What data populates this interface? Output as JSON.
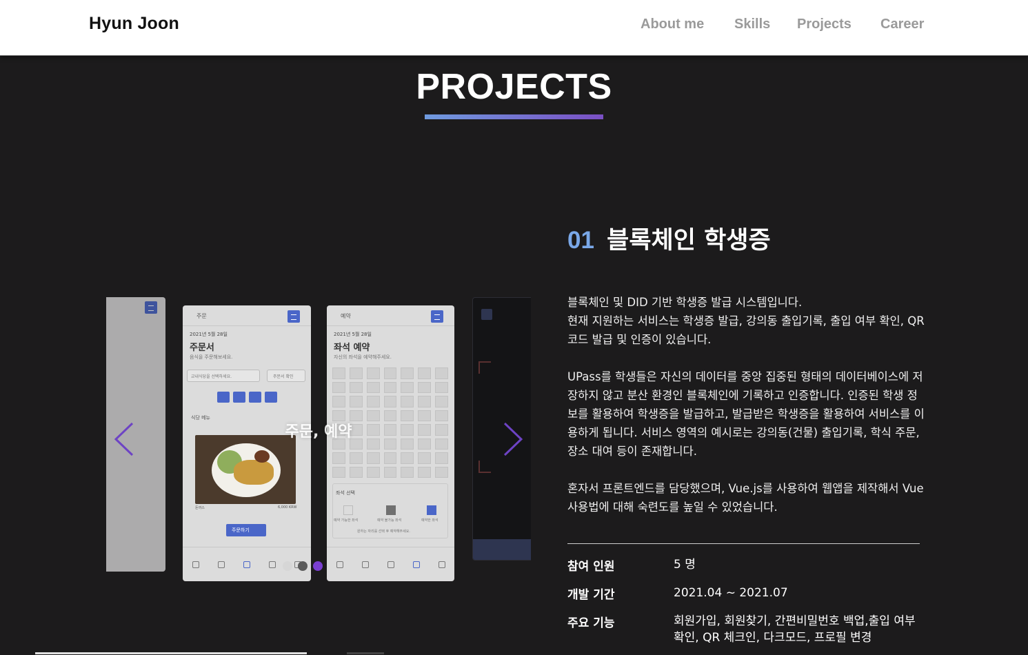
{
  "header": {
    "logo": "Hyun Joon",
    "nav": [
      "About me",
      "Skills",
      "Projects",
      "Career"
    ]
  },
  "section": {
    "title": "PROJECTS"
  },
  "carousel": {
    "overlay": "주문, 예약",
    "active_slide_index": 2,
    "slide_count": 3,
    "slides": {
      "order": {
        "top_label": "주문",
        "date": "2021년 5월 28일",
        "heading": "주문서",
        "sub": "음식을 주문해보세요.",
        "select_placeholder": "교내식당을 선택하세요.",
        "confirm": "주문서 확인",
        "menu_label": "식당 메뉴",
        "item_name": "돈까스",
        "item_price": "6,000 KRW",
        "order_button": "주문하기"
      },
      "reserve": {
        "top_label": "예약",
        "date": "2021년 5월 28일",
        "heading": "좌석 예약",
        "sub": "자신의 좌석을 예약해주세요.",
        "seat_label": "좌석 선택",
        "legend": [
          "예약 가능한 좌석",
          "예약 불가능 좌석",
          "예약한 좌석"
        ],
        "note": "원하는 자리를 선택 후 예약해주세요."
      }
    }
  },
  "project": {
    "number": "01",
    "title": "블록체인 학생증",
    "description": [
      "블록체인 및 DID 기반 학생증 발급 시스템입니다.\n현재 지원하는 서비스는 학생증 발급, 강의동 출입기록, 출입 여부 확인, QR 코드 발급 및 인증이 있습니다.",
      "UPass를 학생들은 자신의 데이터를 중앙 집중된 형태의 데이터베이스에 저장하지 않고 분산 환경인 블록체인에 기록하고 인증합니다. 인증된 학생 정보를 활용하여 학생증을 발급하고, 발급받은 학생증을 활용하여 서비스를 이용하게 됩니다. 서비스 영역의 예시로는 강의동(건물) 출입기록, 학식 주문, 장소 대여 등이 존재합니다.",
      "혼자서 프론트엔드를 담당했으며, Vue.js를 사용하여 웹앱을 제작해서 Vue 사용법에 대해 숙련도를 높일 수 있었습니다."
    ],
    "info": [
      {
        "label": "참여 인원",
        "value": "5 명"
      },
      {
        "label": "개발 기간",
        "value": "2021.04 ~ 2021.07"
      },
      {
        "label": "주요 기능",
        "value": "회원가입, 회원찾기, 간편비밀번호 백업,출입 여부 확인, QR 체크인, 다크모드, 프로필 변경"
      }
    ]
  },
  "colors": {
    "accent_blue": "#7aa8e8",
    "accent_purple": "#7a3fd0",
    "background": "#1c1b1c"
  }
}
